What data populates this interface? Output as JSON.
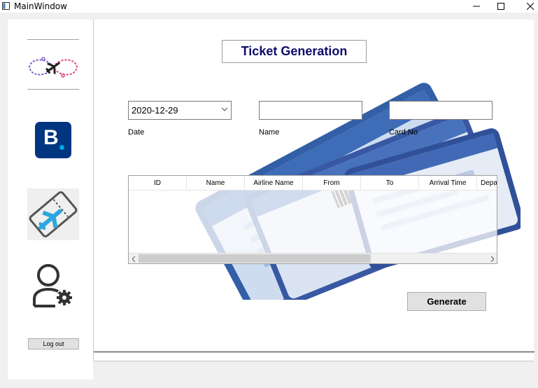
{
  "window": {
    "title": "MainWindow"
  },
  "sidebar": {
    "logout_label": "Log out",
    "booking_letter": "B"
  },
  "main": {
    "heading": "Ticket Generation",
    "date": {
      "value": "2020-12-29",
      "label": "Date"
    },
    "name": {
      "value": "",
      "label": "Name"
    },
    "card": {
      "value": "",
      "label": "Card No"
    },
    "table": {
      "columns": [
        "ID",
        "Name",
        "Airline Name",
        "From",
        "To",
        "Arrival Time",
        "Depa"
      ],
      "rows": []
    },
    "generate_label": "Generate"
  },
  "colors": {
    "heading": "#0c0c6c",
    "booking_blue": "#003580",
    "ticket_blue": "#1d4e9e",
    "plane_cyan": "#29a8e0"
  }
}
